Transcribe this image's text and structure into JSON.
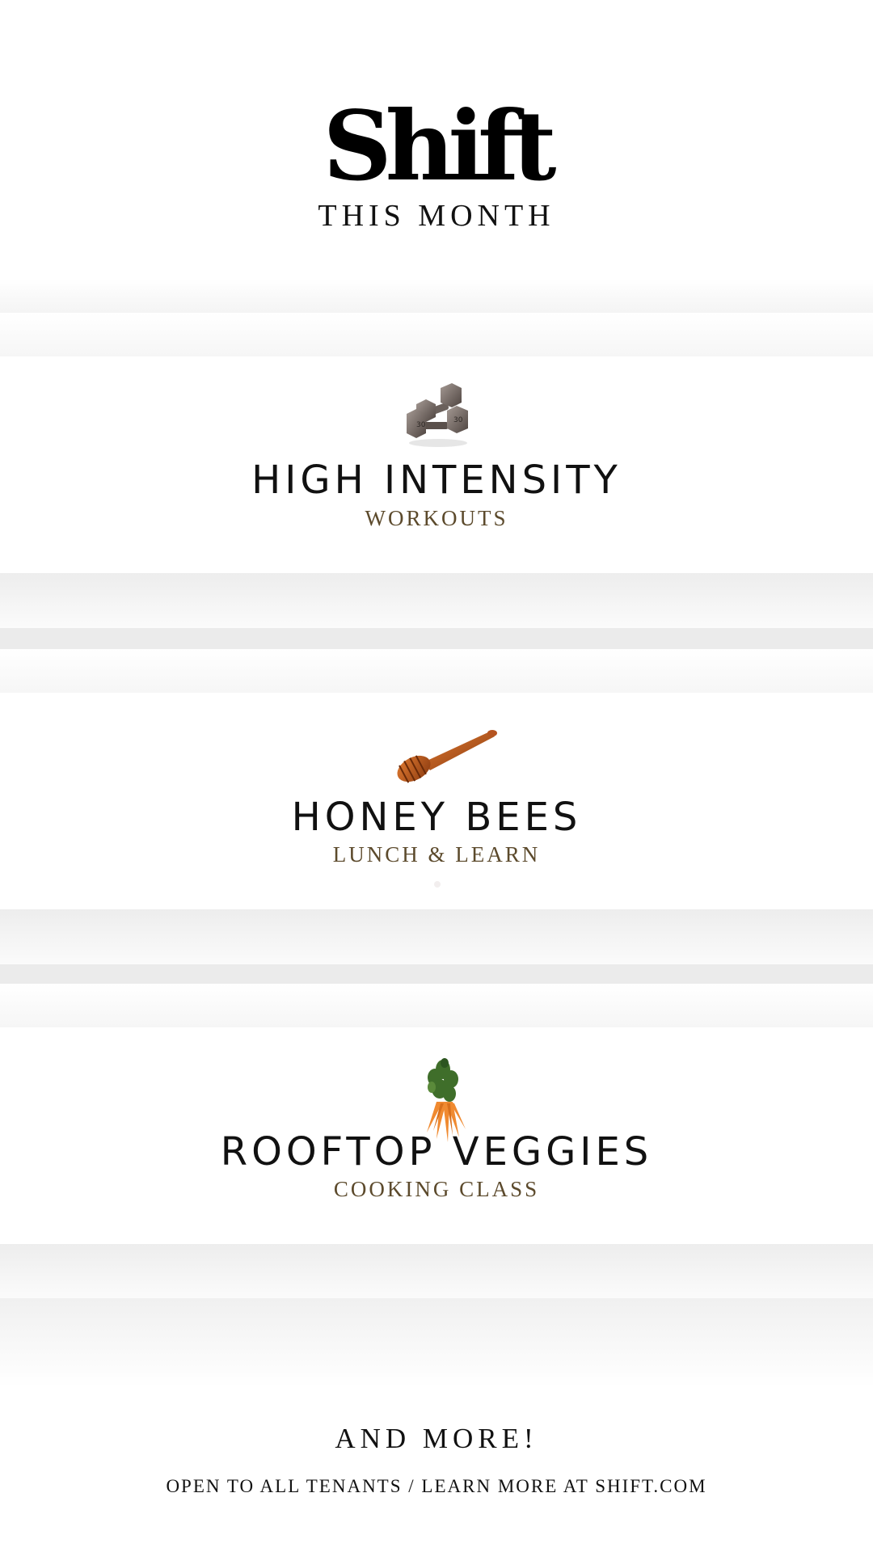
{
  "header": {
    "brand": "Shift",
    "subtitle": "THIS MONTH"
  },
  "events": [
    {
      "title": "HIGH INTENSITY",
      "subtitle": "WORKOUTS",
      "icon": "dumbbells-icon"
    },
    {
      "title": "HONEY BEES",
      "subtitle": "LUNCH & LEARN",
      "icon": "honey-dipper-icon"
    },
    {
      "title": "ROOFTOP VEGGIES",
      "subtitle": "COOKING CLASS",
      "icon": "carrots-icon"
    }
  ],
  "footer": {
    "headline": "AND MORE!",
    "note": "OPEN TO ALL TENANTS / LEARN MORE AT SHIFT.COM"
  },
  "colors": {
    "text": "#111111",
    "subtitle": "#5c4a2c",
    "band_gray": "#ebebeb"
  }
}
